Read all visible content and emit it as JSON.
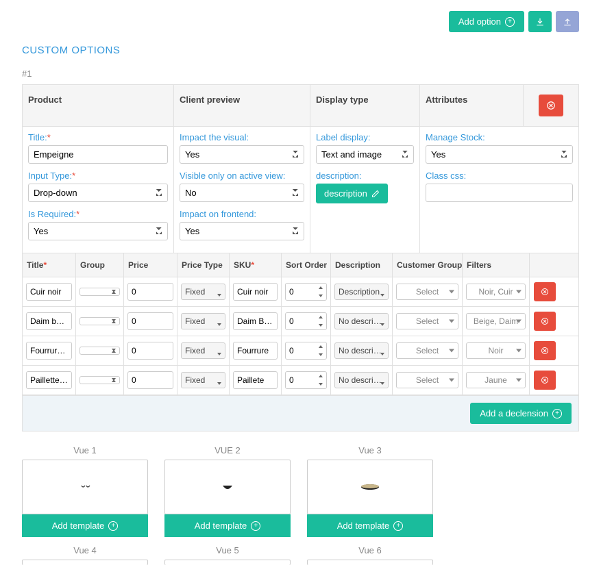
{
  "actions": {
    "add_option": "Add option",
    "import": "import",
    "export": "export"
  },
  "section_title": "CUSTOM OPTIONS",
  "item_number": "#1",
  "panel": {
    "headers": {
      "product": "Product",
      "client": "Client preview",
      "display": "Display type",
      "attributes": "Attributes"
    },
    "product": {
      "title_label": "Title:",
      "title_value": "Empeigne",
      "input_type_label": "Input Type:",
      "input_type_value": "Drop-down",
      "is_required_label": "Is Required:",
      "is_required_value": "Yes"
    },
    "client": {
      "impact_visual_label": "Impact the visual:",
      "impact_visual_value": "Yes",
      "visible_active_label": "Visible only on active view:",
      "visible_active_value": "No",
      "impact_frontend_label": "Impact on frontend:",
      "impact_frontend_value": "Yes"
    },
    "display": {
      "label_display_label": "Label display:",
      "label_display_value": "Text and image",
      "description_label": "description:",
      "description_btn": "description"
    },
    "attributes": {
      "manage_stock_label": "Manage Stock:",
      "manage_stock_value": "Yes",
      "class_css_label": "Class css:",
      "class_css_value": ""
    }
  },
  "grid": {
    "headers": {
      "title": "Title",
      "group": "Group",
      "price": "Price",
      "price_type": "Price Type",
      "sku": "SKU",
      "sort_order": "Sort Order",
      "description": "Description",
      "customer_groups": "Customer Groups",
      "filters": "Filters"
    },
    "rows": [
      {
        "title": "Cuir noir",
        "group": "",
        "price": "0",
        "price_type": "Fixed",
        "sku": "Cuir noir",
        "sort": "0",
        "desc": "Description",
        "cg": "Select",
        "filter": "Noir, Cuir"
      },
      {
        "title": "Daim beige",
        "group": "",
        "price": "0",
        "price_type": "Fixed",
        "sku": "Daim Beige",
        "sort": "0",
        "desc": "No description",
        "cg": "Select",
        "filter": "Beige, Daim"
      },
      {
        "title": "Fourrure noire",
        "group": "",
        "price": "0",
        "price_type": "Fixed",
        "sku": "Fourrure",
        "sort": "0",
        "desc": "No description",
        "cg": "Select",
        "filter": "Noir"
      },
      {
        "title": "Paillettes jaune",
        "group": "",
        "price": "0",
        "price_type": "Fixed",
        "sku": "Paillete",
        "sort": "0",
        "desc": "No description",
        "cg": "Select",
        "filter": "Jaune"
      }
    ],
    "add_declension": "Add a declension"
  },
  "views": {
    "v1": "Vue 1",
    "v2": "VUE 2",
    "v3": "Vue 3",
    "v4": "Vue 4",
    "v5": "Vue 5",
    "v6": "Vue 6",
    "add_template": "Add template"
  }
}
